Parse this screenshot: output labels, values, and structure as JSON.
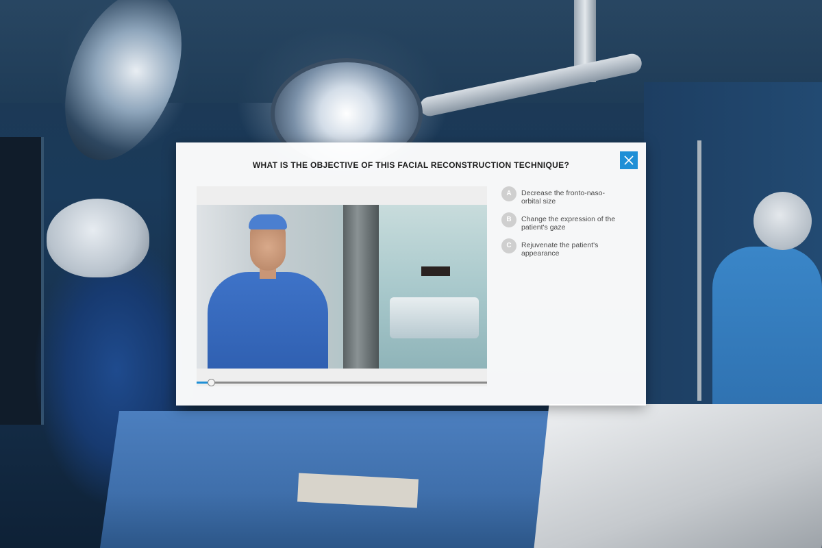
{
  "modal": {
    "title": "WHAT IS THE OBJECTIVE OF THIS FACIAL RECONSTRUCTION TECHNIQUE?",
    "close_icon": "close-icon"
  },
  "video": {
    "progress": 0.05
  },
  "answers": [
    {
      "letter": "A",
      "text": "Decrease the fronto-naso-orbital size"
    },
    {
      "letter": "B",
      "text": "Change the expression of the patient's gaze"
    },
    {
      "letter": "C",
      "text": "Rejuvenate the patient's appearance"
    }
  ],
  "colors": {
    "accent": "#1e8fd6",
    "letter_badge": "#cfcfcf"
  }
}
